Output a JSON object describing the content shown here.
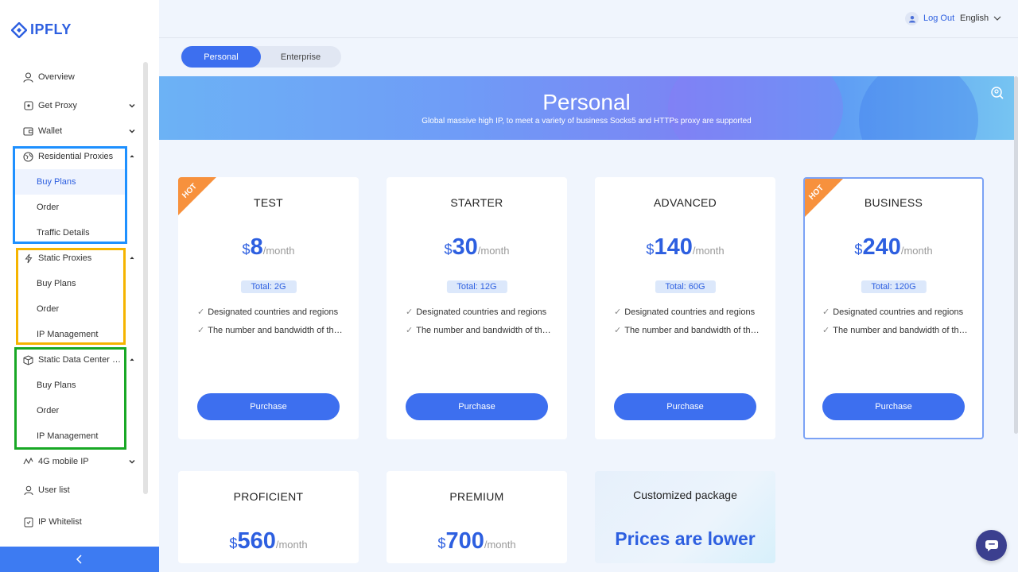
{
  "brand": {
    "name": "IPFLY"
  },
  "header": {
    "logout": "Log Out",
    "language": "English"
  },
  "sidebar": {
    "items": [
      {
        "label": "Overview",
        "icon": "user-icon"
      },
      {
        "label": "Get Proxy",
        "icon": "cube-icon"
      },
      {
        "label": "Wallet",
        "icon": "wallet-icon"
      },
      {
        "label": "Residential Proxies",
        "icon": "globe-icon",
        "sub": [
          "Buy Plans",
          "Order",
          "Traffic Details"
        ]
      },
      {
        "label": "Static Proxies",
        "icon": "lightning-icon",
        "sub": [
          "Buy Plans",
          "Order",
          "IP Management"
        ]
      },
      {
        "label": "Static Data Center Prox...",
        "icon": "box-icon",
        "sub": [
          "Buy Plans",
          "Order",
          "IP Management"
        ]
      },
      {
        "label": "4G mobile IP",
        "icon": "network-icon"
      },
      {
        "label": "User list",
        "icon": "person-icon"
      },
      {
        "label": "IP Whitelist",
        "icon": "shield-icon"
      }
    ],
    "active_sub": "Buy Plans"
  },
  "tabs": {
    "personal": "Personal",
    "enterprise": "Enterprise"
  },
  "banner": {
    "title": "Personal",
    "subtitle": "Global massive high IP, to meet a variety of business Socks5 and HTTPs proxy are supported"
  },
  "plans": [
    {
      "name": "TEST",
      "currency": "$",
      "price": "8",
      "period": "/month",
      "total": "Total:  2G",
      "hot": true,
      "f1": "Designated countries and regions",
      "f2": "The number and bandwidth of threads"
    },
    {
      "name": "STARTER",
      "currency": "$",
      "price": "30",
      "period": "/month",
      "total": "Total:  12G",
      "hot": false,
      "f1": "Designated countries and regions",
      "f2": "The number and bandwidth of threads"
    },
    {
      "name": "ADVANCED",
      "currency": "$",
      "price": "140",
      "period": "/month",
      "total": "Total:  60G",
      "hot": false,
      "f1": "Designated countries and regions",
      "f2": "The number and bandwidth of threads"
    },
    {
      "name": "BUSINESS",
      "currency": "$",
      "price": "240",
      "period": "/month",
      "total": "Total:  120G",
      "hot": true,
      "f1": "Designated countries and regions",
      "f2": "The number and bandwidth of threads"
    },
    {
      "name": "PROFICIENT",
      "currency": "$",
      "price": "560",
      "period": "/month"
    },
    {
      "name": "PREMIUM",
      "currency": "$",
      "price": "700",
      "period": "/month"
    }
  ],
  "hot_label": "HOT",
  "purchase": "Purchase",
  "custom": {
    "title": "Customized package",
    "tagline": "Prices are lower"
  },
  "colors": {
    "accent": "#3d6fef",
    "hot": "#f7913d"
  }
}
